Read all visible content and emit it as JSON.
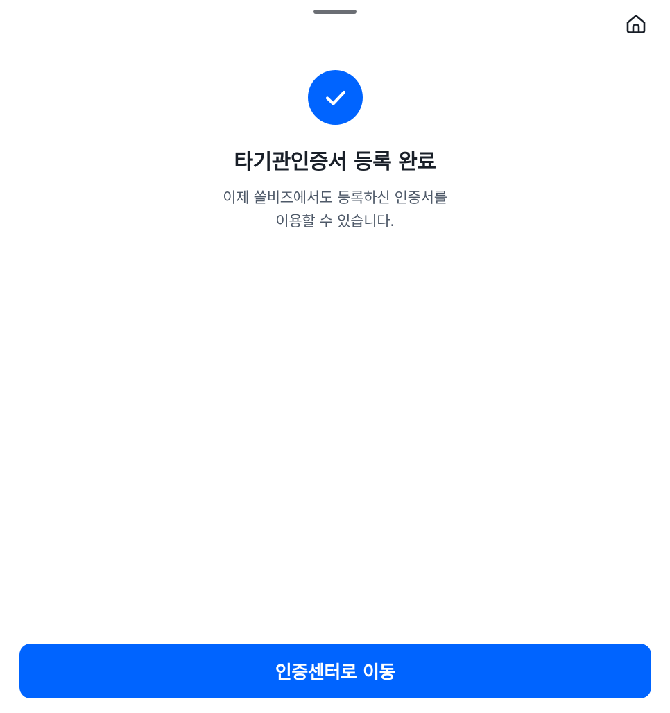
{
  "header": {
    "home_icon": "home-icon"
  },
  "status": {
    "icon": "check-icon",
    "accent_color": "#0064ff"
  },
  "main": {
    "title": "타기관인증서 등록 완료",
    "description_line1": "이제 쏠비즈에서도 등록하신 인증서를",
    "description_line2": "이용할 수 있습니다."
  },
  "footer": {
    "primary_button_label": "인증센터로 이동"
  }
}
